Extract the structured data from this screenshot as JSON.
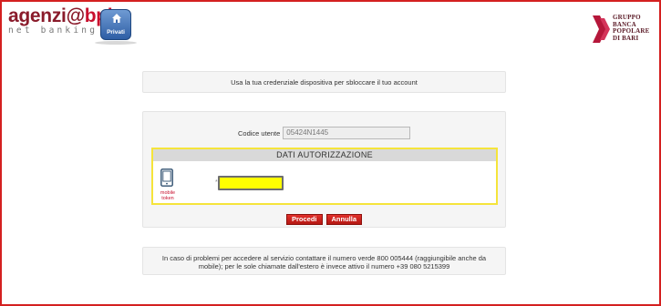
{
  "header": {
    "logo_part1": "agenzi",
    "logo_at": "@",
    "logo_part2": "bpb",
    "logo_subtitle": "net banking",
    "home_button_label": "Privati",
    "brand_lines": [
      "GRUPPO",
      "BANCA",
      "POPOLARE",
      "DI BARI"
    ]
  },
  "notice": {
    "text": "Usa la tua credenziale dispositiva per sbloccare il tuo account"
  },
  "form": {
    "user_code_label": "Codice utente",
    "user_code_value": "05424N1445",
    "auth_header": "DATI AUTORIZZAZIONE",
    "token_label": "mobile token",
    "required_marker": "*",
    "token_value": "",
    "proceed_label": "Procedi",
    "cancel_label": "Annulla"
  },
  "help": {
    "text": "In caso di problemi per accedere al servizio contattare il numero verde 800 005444 (raggiungibile anche da mobile); per le sole chiamate dall'estero è invece attivo il numero +39 080 5215399"
  },
  "colors": {
    "frame": "#d42020",
    "logo_dark": "#8a1b2b",
    "logo_red": "#c8102e",
    "token_field": "#ffff00",
    "auth_border": "#f5e43b",
    "button": "#c8231e"
  },
  "icons": [
    "home-icon",
    "smartphone-icon",
    "brand-chevron-icon"
  ]
}
